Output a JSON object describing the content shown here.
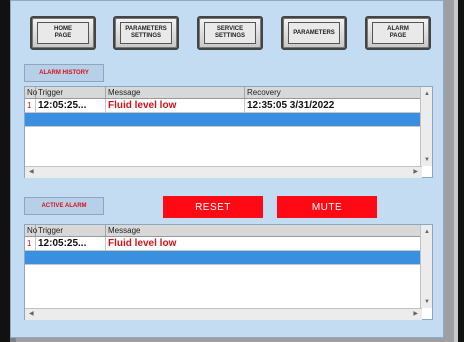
{
  "nav": [
    {
      "label": "HOME\nPAGE"
    },
    {
      "label": "PARAMETERS\nSETTINGS"
    },
    {
      "label": "SERVICE\nSETTINGS"
    },
    {
      "label": "PARAMETERS"
    },
    {
      "label": "ALARM\nPAGE"
    }
  ],
  "alarm_history": {
    "title": "ALARM HISTORY",
    "columns": [
      "No",
      "Trigger",
      "Message",
      "Recovery"
    ],
    "rows": [
      {
        "no": "1",
        "trigger": "12:05:25...",
        "message": "Fluid level low",
        "recovery": "12:35:05 3/31/2022"
      }
    ]
  },
  "active_alarm": {
    "title": "ACTIVE ALARM",
    "columns": [
      "No",
      "Trigger",
      "Message"
    ],
    "rows": [
      {
        "no": "1",
        "trigger": "12:05:25...",
        "message": "Fluid level low"
      }
    ]
  },
  "buttons": {
    "reset": "RESET",
    "mute": "MUTE"
  },
  "colors": {
    "panel": "#c4dcf1",
    "alarm_red": "#ff0a14",
    "selection": "#3a8fe0"
  }
}
